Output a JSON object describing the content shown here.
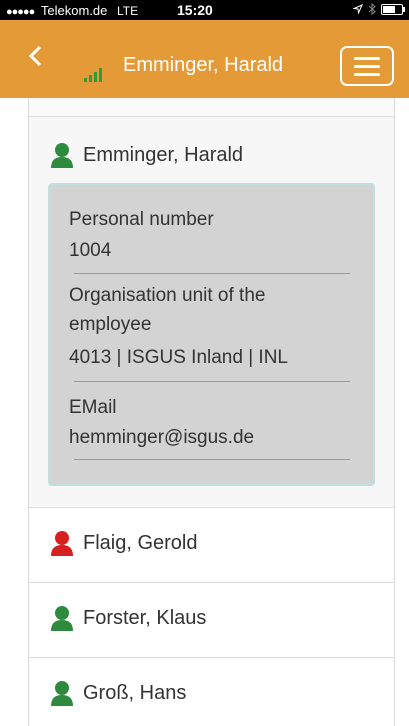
{
  "status_bar": {
    "signal_dots": "●●●●●",
    "carrier": "Telekom.de",
    "network": "LTE",
    "time": "15:20"
  },
  "header": {
    "back_symbol": "<",
    "title": "Emminger, Harald"
  },
  "colors": {
    "header_bg": "#e39a37",
    "status_green": "#2e8b3e",
    "status_red": "#d61f1f"
  },
  "selected_employee": {
    "name": "Emminger, Harald",
    "status_icon": "person-green-icon",
    "fields": [
      {
        "label": "Personal number",
        "value": "1004"
      },
      {
        "label": "Organisation unit of the employee",
        "value": "4013 | ISGUS Inland | INL"
      },
      {
        "label": "EMail",
        "value": "hemminger@isgus.de"
      }
    ]
  },
  "employees": [
    {
      "name": "Flaig, Gerold",
      "status_icon": "person-red-icon"
    },
    {
      "name": "Forster, Klaus",
      "status_icon": "person-green-icon"
    },
    {
      "name": "Groß, Hans",
      "status_icon": "person-green-icon"
    }
  ]
}
